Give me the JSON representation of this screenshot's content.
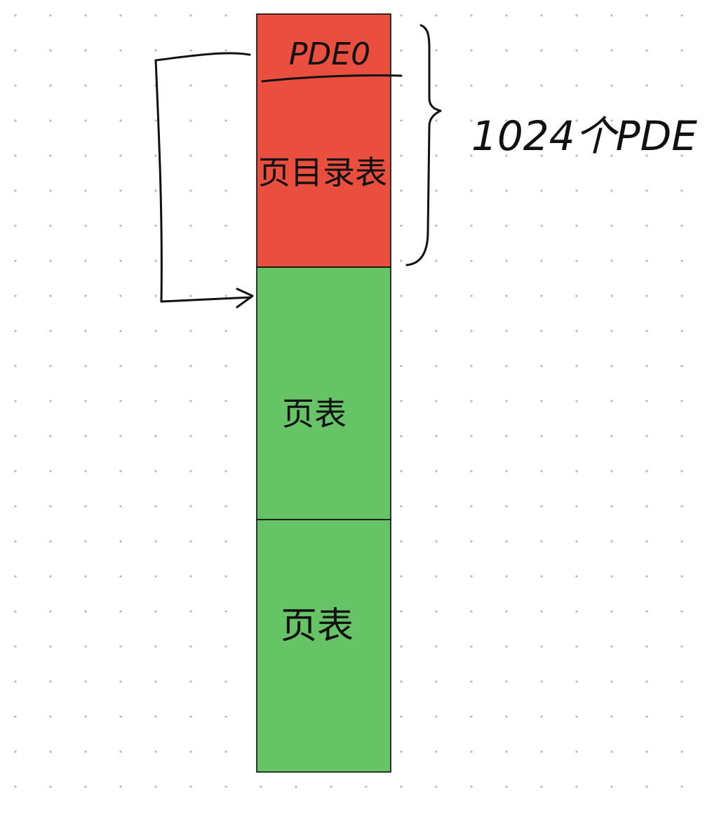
{
  "colors": {
    "background": "#ffffff",
    "dot_grid": "#b9b9b9",
    "page_directory": "#e94e3f",
    "page_table": "#66c466",
    "outline": "#000000",
    "ink": "#111111"
  },
  "diagram": {
    "blocks": [
      {
        "id": "page-directory",
        "entry_label": "PDE0",
        "label": "页目录表",
        "color_key": "page_directory"
      },
      {
        "id": "page-table-1",
        "label": "页表",
        "color_key": "page_table"
      },
      {
        "id": "page-table-2",
        "label": "页表",
        "color_key": "page_table"
      }
    ],
    "brace_annotation": "1024个PDE"
  }
}
